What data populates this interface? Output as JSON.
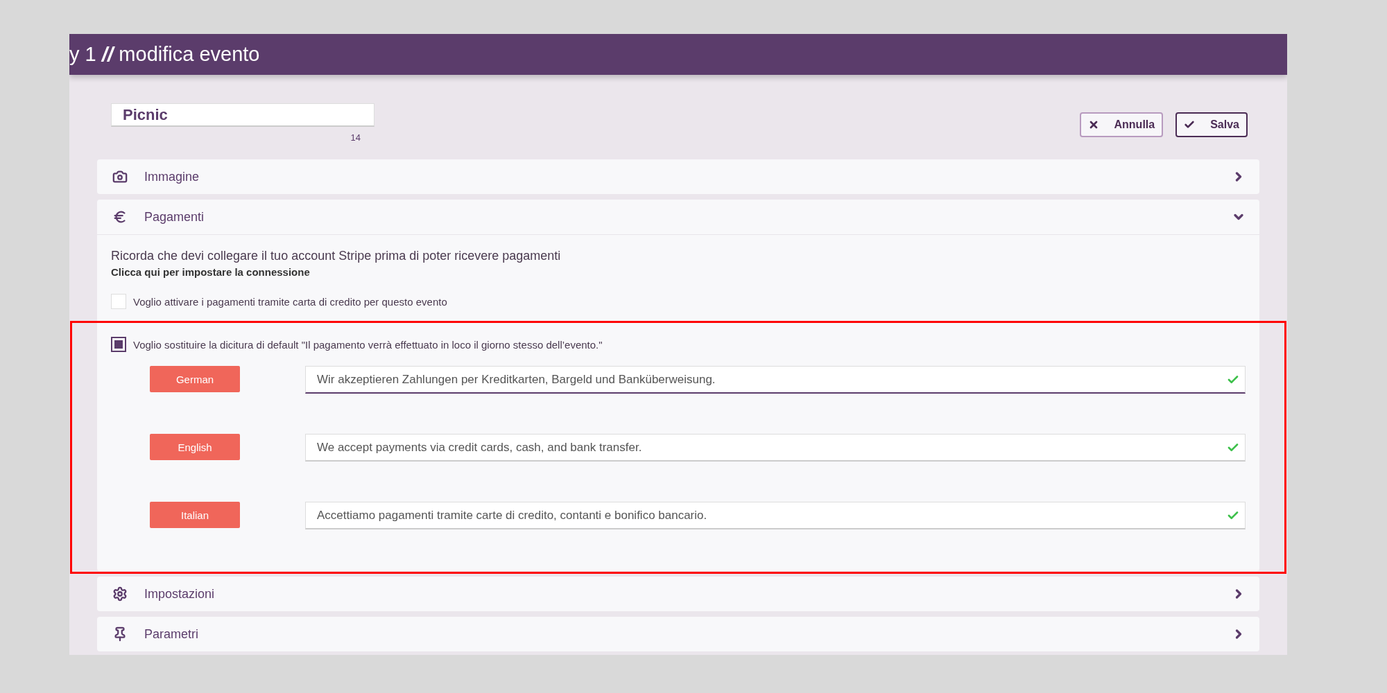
{
  "header": {
    "breadcrumb": "y 1",
    "separator": "//",
    "page": "modifica evento"
  },
  "name_field": {
    "value": "Picnic",
    "counter": "14"
  },
  "buttons": [
    {
      "kind": "cancel",
      "label": "Annulla"
    },
    {
      "kind": "save",
      "label": "Salva"
    }
  ],
  "sections": [
    {
      "kind": "image",
      "title": "Immagine",
      "expanded": false
    },
    {
      "kind": "payments",
      "title": "Pagamenti",
      "expanded": true
    },
    {
      "kind": "settings",
      "title": "Impostazioni",
      "expanded": false
    },
    {
      "kind": "parameters",
      "title": "Parametri",
      "expanded": false
    }
  ],
  "payments": {
    "notice": "Ricorda che devi collegare il tuo account Stripe prima di poter ricevere pagamenti",
    "link": "Clicca qui per impostare la connessione",
    "card_option": {
      "label": "Voglio attivare i pagamenti tramite carta di credito per questo evento",
      "checked": false
    },
    "replace_option": {
      "label": "Voglio sostituire la dicitura di default \"Il pagamento verrà effettuato in loco il giorno stesso dell’evento.\"",
      "checked": true
    },
    "translations": [
      {
        "language": "German",
        "text": "Wir akzeptieren Zahlungen per Kreditkarten, Bargeld und Banküberweisung.",
        "focused": true,
        "valid": true
      },
      {
        "language": "English",
        "text": "We accept payments via credit cards, cash, and bank transfer.",
        "focused": false,
        "valid": true
      },
      {
        "language": "Italian",
        "text": "Accettiamo pagamenti tramite carte di credito, contanti e bonifico bancario.",
        "focused": false,
        "valid": true
      }
    ]
  },
  "highlight": {
    "shown": true
  }
}
